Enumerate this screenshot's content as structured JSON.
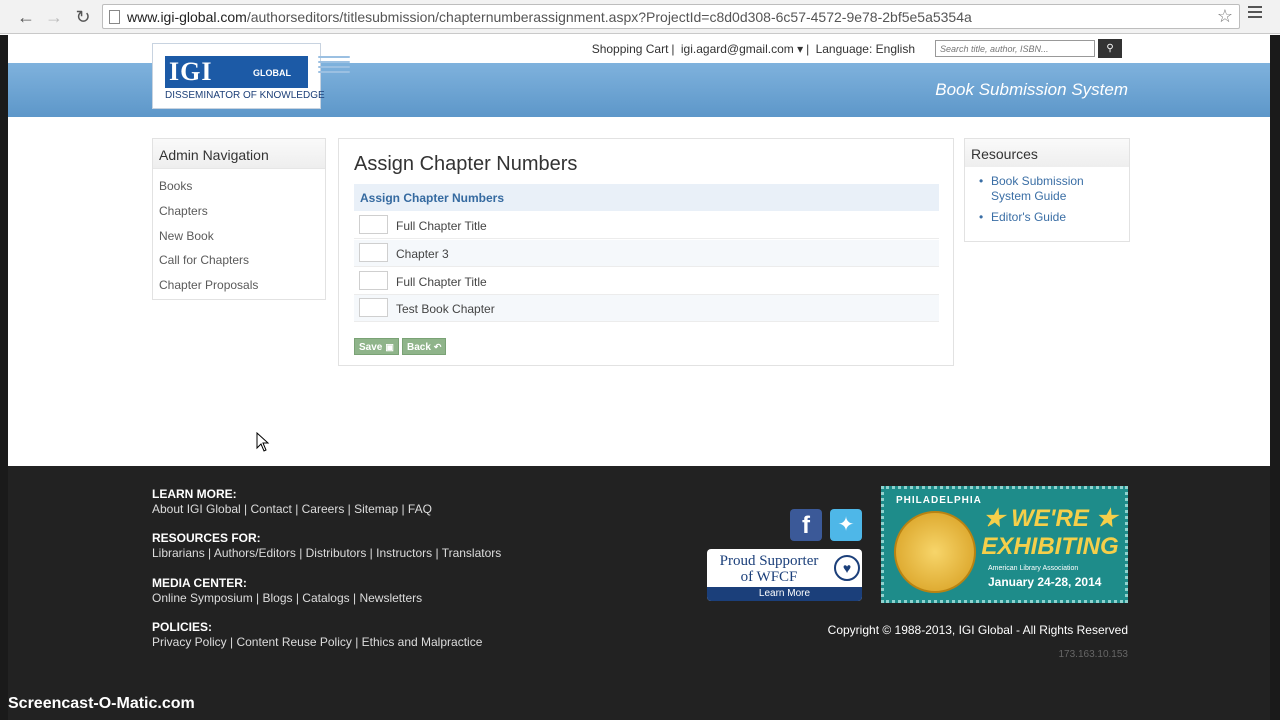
{
  "browser": {
    "url_host": "www.igi-global.com",
    "url_path": "/authorseditors/titlesubmission/chapternumberassignment.aspx?ProjectId=c8d0d308-6c57-4572-9e78-2bf5e5a5354a",
    "back_icon": "back-arrow-icon",
    "forward_icon": "forward-arrow-icon",
    "reload_icon": "reload-icon"
  },
  "header": {
    "logo_text": "IGI",
    "logo_sub": "GLOBAL",
    "logo_tagline": "DISSEMINATOR OF KNOWLEDGE",
    "shopping_cart": "Shopping Cart",
    "user_email": "igi.agard@gmail.com ▾",
    "language": "Language: English",
    "search_placeholder": "Search title, author, ISBN...",
    "system_title": "Book Submission System"
  },
  "admin_nav": {
    "title": "Admin Navigation",
    "items": [
      "Books",
      "Chapters",
      "New Book",
      "Call for Chapters",
      "Chapter Proposals"
    ]
  },
  "main": {
    "page_title": "Assign Chapter Numbers",
    "section_title": "Assign Chapter Numbers",
    "chapters": [
      {
        "number": "",
        "title": "Full Chapter Title"
      },
      {
        "number": "",
        "title": "Chapter 3"
      },
      {
        "number": "",
        "title": "Full Chapter Title"
      },
      {
        "number": "",
        "title": "Test Book Chapter"
      }
    ],
    "save_label": "Save",
    "back_label": "Back"
  },
  "resources": {
    "title": "Resources",
    "links": [
      "Book Submission System Guide",
      "Editor's Guide"
    ]
  },
  "footer": {
    "learn_more_head": "LEARN MORE:",
    "learn_more_links": "About IGI Global | Contact | Careers | Sitemap | FAQ",
    "resources_head": "RESOURCES FOR:",
    "resources_links": "Librarians | Authors/Editors | Distributors | Instructors | Translators",
    "media_head": "MEDIA CENTER:",
    "media_links": "Online Symposium | Blogs | Catalogs | Newsletters",
    "policies_head": "POLICIES:",
    "policies_links": "Privacy Policy | Content Reuse Policy | Ethics and Malpractice",
    "wfcf_text": "Proud Supporter of WFCF",
    "wfcf_learn": "Learn More",
    "ala_city": "PHILADELPHIA",
    "ala_exhibiting": "★ WE'RE ★ EXHIBITING",
    "ala_org": "American Library Association",
    "ala_dates": "January 24-28, 2014",
    "copyright": "Copyright © 1988-2013, IGI Global - All Rights Reserved",
    "ip": "173.163.10.153"
  },
  "watermark": "Screencast-O-Matic.com",
  "colors": {
    "header_blue": "#6fa6d6",
    "footer_bg": "#222222",
    "link_blue": "#3a6ea5",
    "button_green": "#8fb48a"
  }
}
